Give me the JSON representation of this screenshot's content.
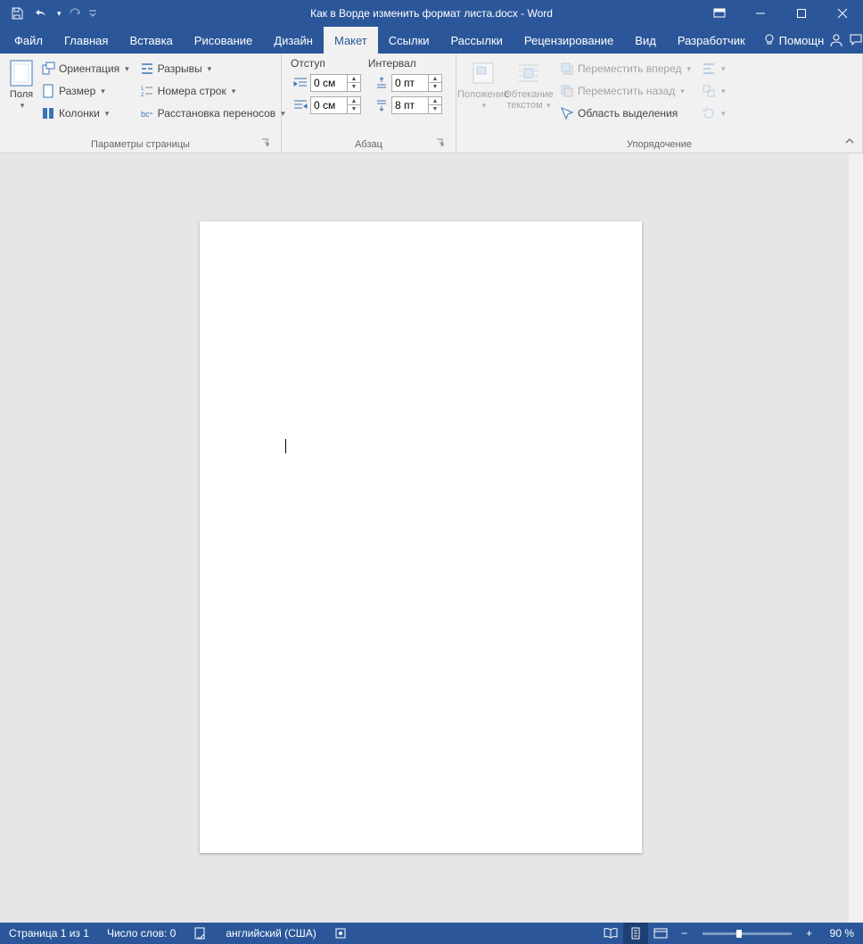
{
  "title": "Как в Ворде изменить формат листа.docx  -  Word",
  "tabs": [
    "Файл",
    "Главная",
    "Вставка",
    "Рисование",
    "Дизайн",
    "Макет",
    "Ссылки",
    "Рассылки",
    "Рецензирование",
    "Вид",
    "Разработчик"
  ],
  "active_tab": "Макет",
  "help_label": "Помощн",
  "ribbon": {
    "page_setup": {
      "label": "Параметры страницы",
      "margins": "Поля",
      "orientation": "Ориентация",
      "size": "Размер",
      "columns": "Колонки",
      "breaks": "Разрывы",
      "line_numbers": "Номера строк",
      "hyphenation": "Расстановка переносов"
    },
    "paragraph": {
      "label": "Абзац",
      "indent_header": "Отступ",
      "spacing_header": "Интервал",
      "indent_left": "0 см",
      "indent_right": "0 см",
      "space_before": "0 пт",
      "space_after": "8 пт"
    },
    "arrange": {
      "label": "Упорядочение",
      "position": "Положение",
      "wrap": "Обтекание текстом",
      "bring_forward": "Переместить вперед",
      "send_backward": "Переместить назад",
      "selection_pane": "Область выделения"
    }
  },
  "status": {
    "page": "Страница 1 из 1",
    "words": "Число слов: 0",
    "language": "английский (США)",
    "zoom": "90 %"
  }
}
